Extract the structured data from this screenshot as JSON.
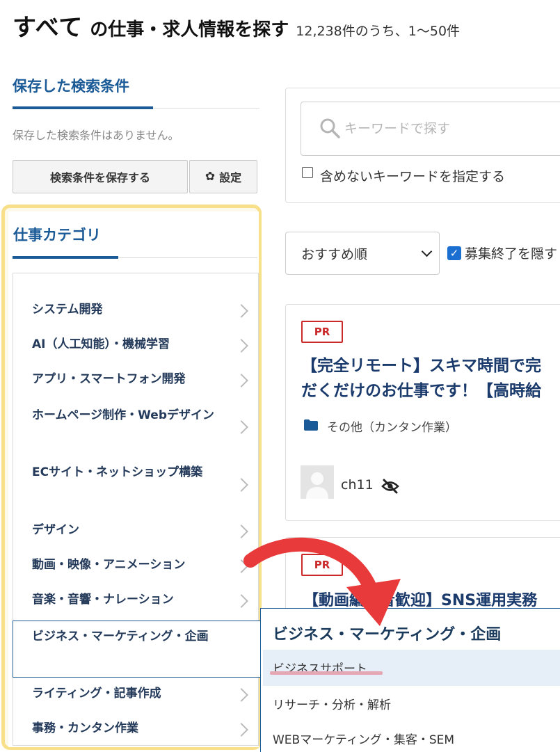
{
  "header": {
    "category_all": "すべて",
    "title": "の仕事・求人情報を探す",
    "count_text": "12,238件のうち、1〜50件"
  },
  "saved_search": {
    "title": "保存した検索条件",
    "empty_text": "保存した検索条件はありません。",
    "save_button": "検索条件を保存する",
    "settings_button": "設定"
  },
  "category": {
    "title": "仕事カテゴリ",
    "items": [
      {
        "label": "システム開発"
      },
      {
        "label": "AI（人工知能）・機械学習"
      },
      {
        "label": "アプリ・スマートフォン開発"
      },
      {
        "label": "ホームページ制作・Webデザイン"
      },
      {
        "label": "ECサイト・ネットショップ構築"
      },
      {
        "label": "デザイン"
      },
      {
        "label": "動画・映像・アニメーション"
      },
      {
        "label": "音楽・音響・ナレーション"
      },
      {
        "label": "ビジネス・マーケティング・企画"
      },
      {
        "label": "ライティング・記事作成"
      },
      {
        "label": "事務・カンタン作業"
      }
    ],
    "active_index": 8
  },
  "submenu": {
    "title": "ビジネス・マーケティング・企画",
    "items": [
      {
        "label": "ビジネスサポート"
      },
      {
        "label": "リサーチ・分析・解析"
      },
      {
        "label": "WEBマーケティング・集客・SEM"
      }
    ]
  },
  "search": {
    "placeholder": "キーワードで探す",
    "exclude_label": "含めないキーワードを指定する"
  },
  "sort": {
    "selected": "おすすめ順",
    "hide_closed_label": "募集終了を隠す"
  },
  "jobs": [
    {
      "badge": "PR",
      "title_line1": "【完全リモート】スキマ時間で完",
      "title_line2": "だくだけのお仕事です！【高時給",
      "category": "その他（カンタン作業）",
      "user": "ch11"
    },
    {
      "badge": "PR",
      "title_line1": "【動画編集者歓迎】SNS運用実務"
    }
  ],
  "colors": {
    "accent": "#1a5a96",
    "pr_red": "#cc2a2a",
    "highlight": "#f8e08b",
    "arrow": "#e83a3a",
    "checkbox": "#1a6fd0"
  }
}
